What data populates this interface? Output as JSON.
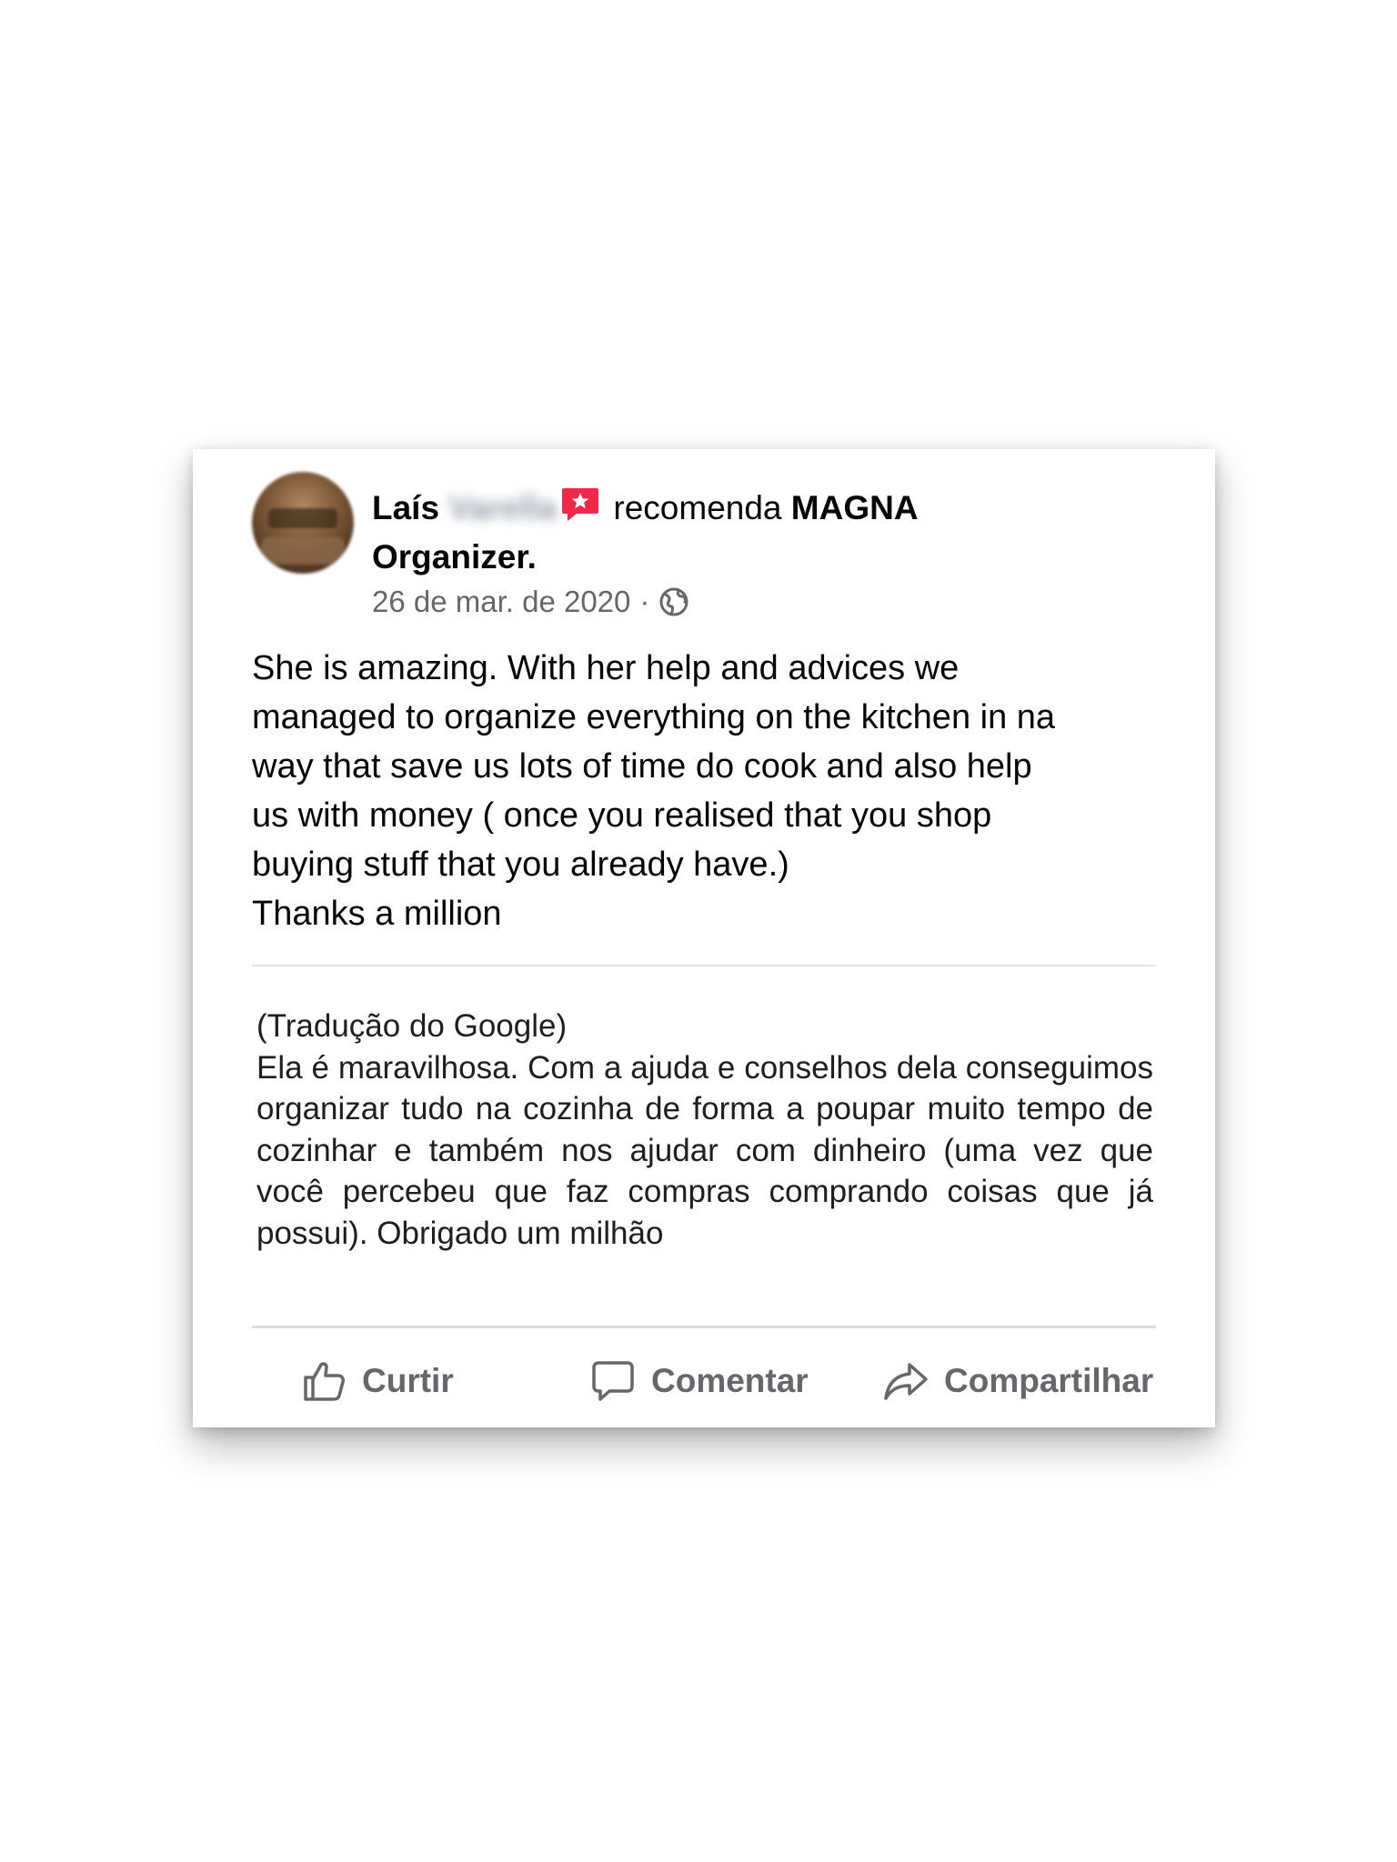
{
  "post": {
    "author_first_name": "Laís",
    "author_last_name": "Varella",
    "recommends_text": "recomenda",
    "page_name_line1": "MAGNA",
    "page_name_line2": "Organizer.",
    "date": "26 de mar. de 2020",
    "separator": "·",
    "icons": {
      "recommend": "recommendation-star-icon",
      "audience": "globe-icon"
    },
    "review_text": "She is amazing. With her help and advices we\nmanaged to organize everything on the kitchen in na\nway that save us lots of time do cook and also help\nus with money ( once you realised that you shop\nbuying stuff that you already have.)\nThanks a million"
  },
  "translation": {
    "label": "(Tradução do Google)",
    "text": "Ela é maravilhosa. Com a ajuda e conselhos dela conseguimos organizar tudo na cozinha de forma a poupar muito tempo de cozinhar e também nos ajudar com dinheiro (uma vez que você percebeu que faz compras comprando coisas que já possui). Obrigado um milhão"
  },
  "actions": {
    "like_label": "Curtir",
    "comment_label": "Comentar",
    "share_label": "Compartilhar"
  },
  "colors": {
    "recommend_badge": "#f02849",
    "secondary_text": "#65676b",
    "primary_text": "#050505"
  }
}
